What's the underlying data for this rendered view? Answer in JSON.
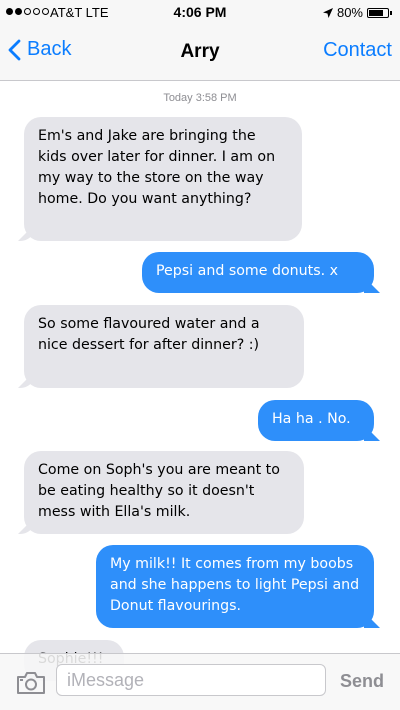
{
  "status_bar": {
    "carrier": "AT&T  LTE",
    "time": "4:06 PM",
    "battery_text": "80%",
    "battery_level": 0.8,
    "signal_bars": 2
  },
  "nav": {
    "back_label": "Back",
    "title": "Arry",
    "contact_label": "Contact"
  },
  "conversation": {
    "timestamp": "Today 3:58 PM",
    "messages": [
      {
        "from": "them",
        "text": "Em's and Jake are bringing the kids over later for dinner. I am on my way to the store on the way home. Do you want anything?"
      },
      {
        "from": "me",
        "text": "Pepsi and some donuts. x"
      },
      {
        "from": "them",
        "text": "So some flavoured water and a nice dessert for after dinner? :)"
      },
      {
        "from": "me",
        "text": "Ha ha . No."
      },
      {
        "from": "them",
        "text": "Come on Soph's you are meant to be eating healthy so it doesn't mess with Ella's milk."
      },
      {
        "from": "me",
        "text": "My milk!! It comes from my boobs and she happens to light Pepsi and Donut flavourings."
      },
      {
        "from": "them",
        "text": "Sophie!!!"
      }
    ]
  },
  "input": {
    "placeholder": "iMessage",
    "value": "",
    "send_label": "Send"
  },
  "colors": {
    "accent": "#0b7dff",
    "outgoing_bubble": "#2e8ffa",
    "incoming_bubble": "#e5e5ea"
  },
  "icons": [
    "chevron-left-icon",
    "location-arrow-icon",
    "battery-icon",
    "camera-icon"
  ]
}
